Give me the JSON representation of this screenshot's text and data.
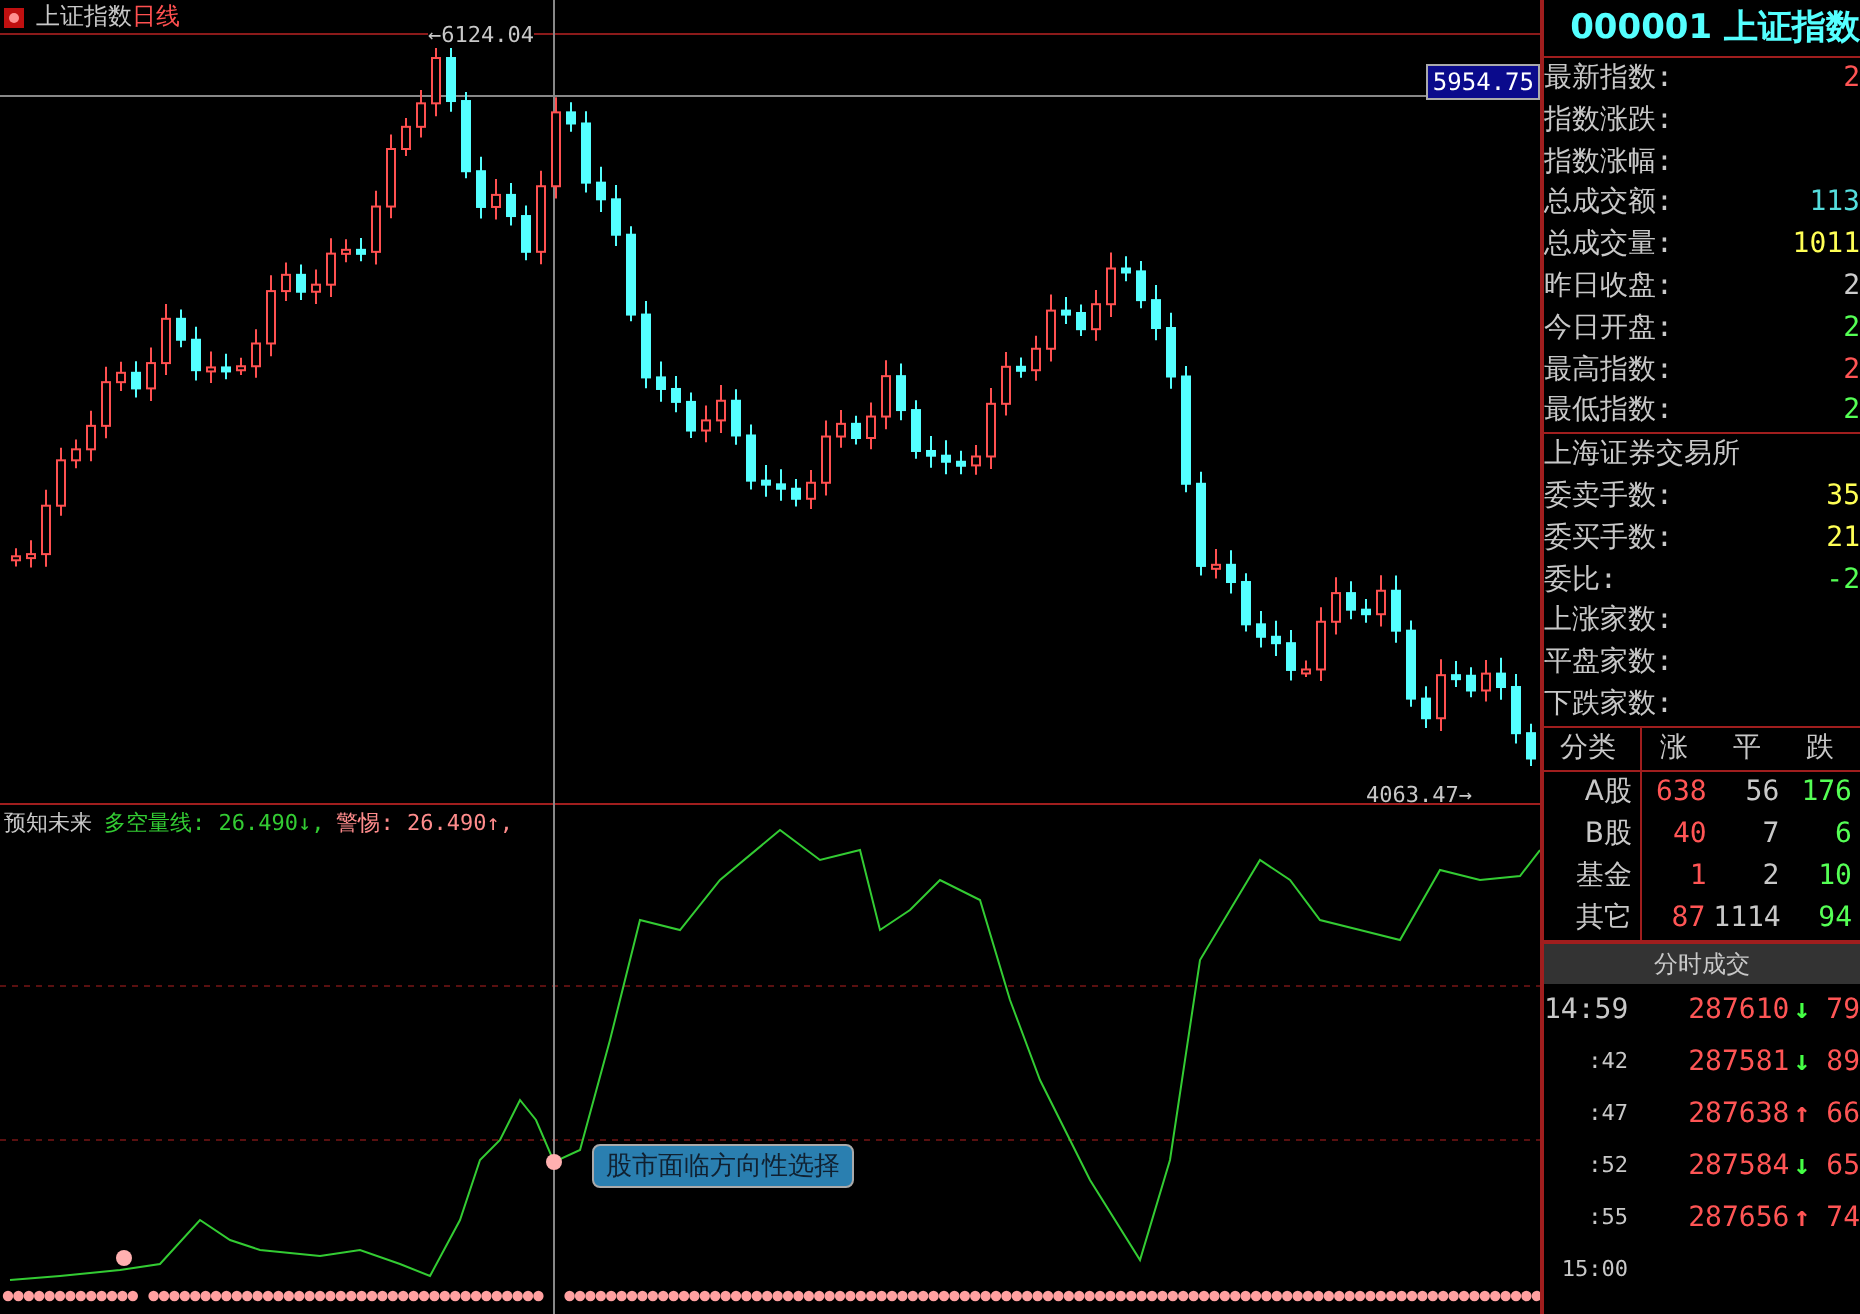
{
  "chart": {
    "title": "上证指数",
    "period": "日线",
    "high_label": "←6124.04",
    "low_label": "4063.47→",
    "cursor_price": "5954.75"
  },
  "indicator": {
    "name": "预知未来",
    "series": [
      {
        "label": "多空量线: 26.490↓,",
        "color": "#33cc33"
      },
      {
        "label": "警惕: 26.490↑,",
        "color": "#ff8c8c"
      }
    ],
    "alert": "股市面临方向性选择"
  },
  "quote": {
    "code": "000001",
    "name": "上证指数",
    "fields": [
      {
        "label": "最新指数:",
        "value": "2",
        "color": "#ff5555"
      },
      {
        "label": "指数涨跌:"
      },
      {
        "label": "指数涨幅:"
      },
      {
        "label": "总成交额:",
        "value": "113",
        "color": "#55dddd"
      },
      {
        "label": "总成交量:",
        "value": "1011",
        "color": "#ffff55"
      },
      {
        "label": "昨日收盘:",
        "value": "2",
        "color": "#cccccc"
      },
      {
        "label": "今日开盘:",
        "value": "2",
        "color": "#55ff55"
      },
      {
        "label": "最高指数:",
        "value": "2",
        "color": "#ff5555"
      },
      {
        "label": "最低指数:",
        "value": "2",
        "color": "#55ff55"
      }
    ]
  },
  "exchange": {
    "title": "上海证券交易所",
    "fields": [
      {
        "label": "委卖手数:",
        "value": "35",
        "color": "#ffff55"
      },
      {
        "label": "委买手数:",
        "value": "21",
        "color": "#ffff55"
      },
      {
        "label": "委比:",
        "value": "-2",
        "color": "#55ff55"
      },
      {
        "label": "上涨家数:"
      },
      {
        "label": "平盘家数:"
      },
      {
        "label": "下跌家数:"
      }
    ]
  },
  "breadth": {
    "columns": [
      "分类",
      "涨",
      "平",
      "跌"
    ],
    "rows": [
      {
        "category": "A股",
        "up": "638",
        "flat": "56",
        "down": "176"
      },
      {
        "category": "B股",
        "up": "40",
        "flat": "7",
        "down": "6"
      },
      {
        "category": "基金",
        "up": "1",
        "flat": "2",
        "down": "10"
      },
      {
        "category": "其它",
        "up": "87",
        "flat": "1114",
        "down": "94"
      }
    ]
  },
  "ticks": {
    "title": "分时成交",
    "rows": [
      {
        "time": "14:59",
        "price": "287610",
        "arrow": "↓",
        "color": "#44ff44",
        "volume": "79"
      },
      {
        "time": ":42",
        "price": "287581",
        "arrow": "↓",
        "color": "#44ff44",
        "volume": "89"
      },
      {
        "time": ":47",
        "price": "287638",
        "arrow": "↑",
        "color": "#ff5555",
        "volume": "66"
      },
      {
        "time": ":52",
        "price": "287584",
        "arrow": "↓",
        "color": "#44ff44",
        "volume": "65"
      },
      {
        "time": ":55",
        "price": "287656",
        "arrow": "↑",
        "color": "#ff5555",
        "volume": "74"
      },
      {
        "time": "15:00"
      }
    ]
  }
}
